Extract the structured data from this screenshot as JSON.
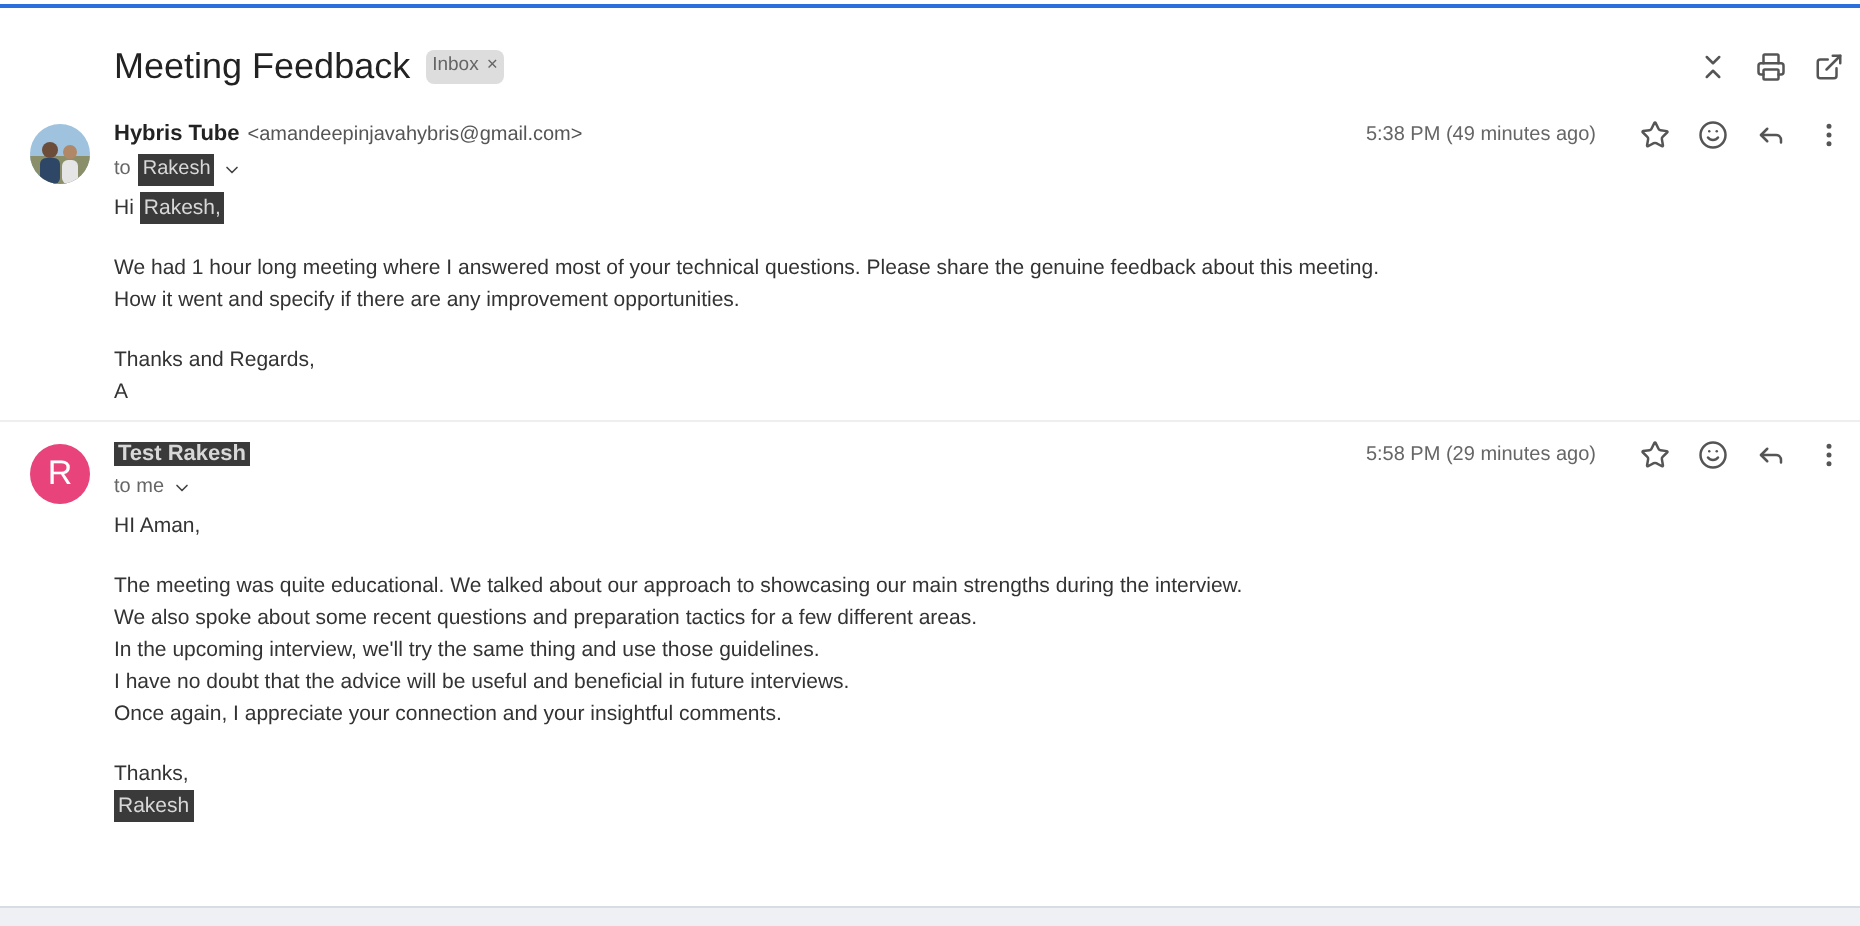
{
  "subject": "Meeting Feedback",
  "label": {
    "text": "Inbox",
    "remove": "×"
  },
  "messages": [
    {
      "avatar": {
        "kind": "picture"
      },
      "sender": {
        "text": "Hybris Tube",
        "redacted": false
      },
      "email": "<amandeepinjavahybris@gmail.com>",
      "time": "5:38 PM (49 minutes ago)",
      "recipient": [
        {
          "text": "to",
          "redacted": false
        },
        {
          "text": "Rakesh",
          "redacted": true
        }
      ],
      "paragraphs": [
        [
          [
            {
              "text": "Hi",
              "redacted": false
            },
            {
              "text": "Rakesh,",
              "redacted": true
            }
          ]
        ],
        [
          [
            {
              "text": "We had 1 hour long meeting where I answered most of your technical questions. Please share the genuine feedback about this meeting.",
              "redacted": false
            }
          ],
          [
            {
              "text": "How it went and specify if there are any improvement opportunities.",
              "redacted": false
            }
          ]
        ],
        [
          [
            {
              "text": "Thanks and Regards,",
              "redacted": false
            }
          ],
          [
            {
              "text": "A",
              "redacted": false
            }
          ]
        ]
      ]
    },
    {
      "avatar": {
        "kind": "letter",
        "letter": "R",
        "color": "#e8437a"
      },
      "sender": {
        "text": "Test Rakesh",
        "redacted": true
      },
      "time": "5:58 PM (29 minutes ago)",
      "recipient": [
        {
          "text": "to me",
          "redacted": false
        }
      ],
      "paragraphs": [
        [
          [
            {
              "text": "HI Aman,",
              "redacted": false
            }
          ]
        ],
        [
          [
            {
              "text": "The meeting was quite educational. We talked about our approach to showcasing our main strengths during the interview.",
              "redacted": false
            }
          ],
          [
            {
              "text": "We also spoke about some recent questions and preparation tactics for a few different areas.",
              "redacted": false
            }
          ],
          [
            {
              "text": "In the upcoming interview, we'll try the same thing and use those guidelines.",
              "redacted": false
            }
          ],
          [
            {
              "text": "I have no doubt that the advice will be useful and beneficial in future interviews.",
              "redacted": false
            }
          ],
          [
            {
              "text": "Once again, I appreciate your connection and your insightful comments.",
              "redacted": false
            }
          ]
        ],
        [
          [
            {
              "text": "Thanks,",
              "redacted": false
            }
          ],
          [
            {
              "text": "Rakesh",
              "redacted": true
            }
          ]
        ]
      ]
    }
  ]
}
